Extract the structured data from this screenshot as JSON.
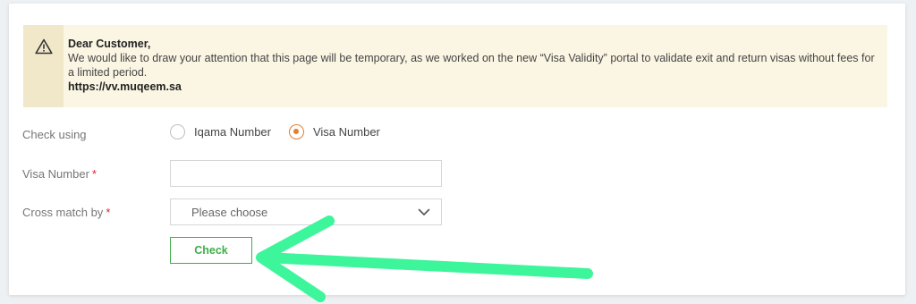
{
  "notice": {
    "icon": "warning-triangle-icon",
    "title": "Dear Customer,",
    "body": "We would like to draw your attention that this page will be temporary, as we worked on the new “Visa Validity” portal to validate exit and return visas without fees for a limited period.",
    "link": "https://vv.muqeem.sa"
  },
  "form": {
    "check_using": {
      "label": "Check using",
      "options": [
        {
          "label": "Iqama Number",
          "selected": false
        },
        {
          "label": "Visa Number",
          "selected": true
        }
      ]
    },
    "visa_number": {
      "label": "Visa Number",
      "required_mark": "*",
      "value": ""
    },
    "cross_match": {
      "label": "Cross match by",
      "required_mark": "*",
      "selected": "Please choose"
    },
    "submit_label": "Check"
  },
  "colors": {
    "accent_orange": "#e27e2f",
    "button_green": "#3fae49",
    "arrow_green": "#3df59a",
    "notice_bg": "#fbf6e3"
  }
}
